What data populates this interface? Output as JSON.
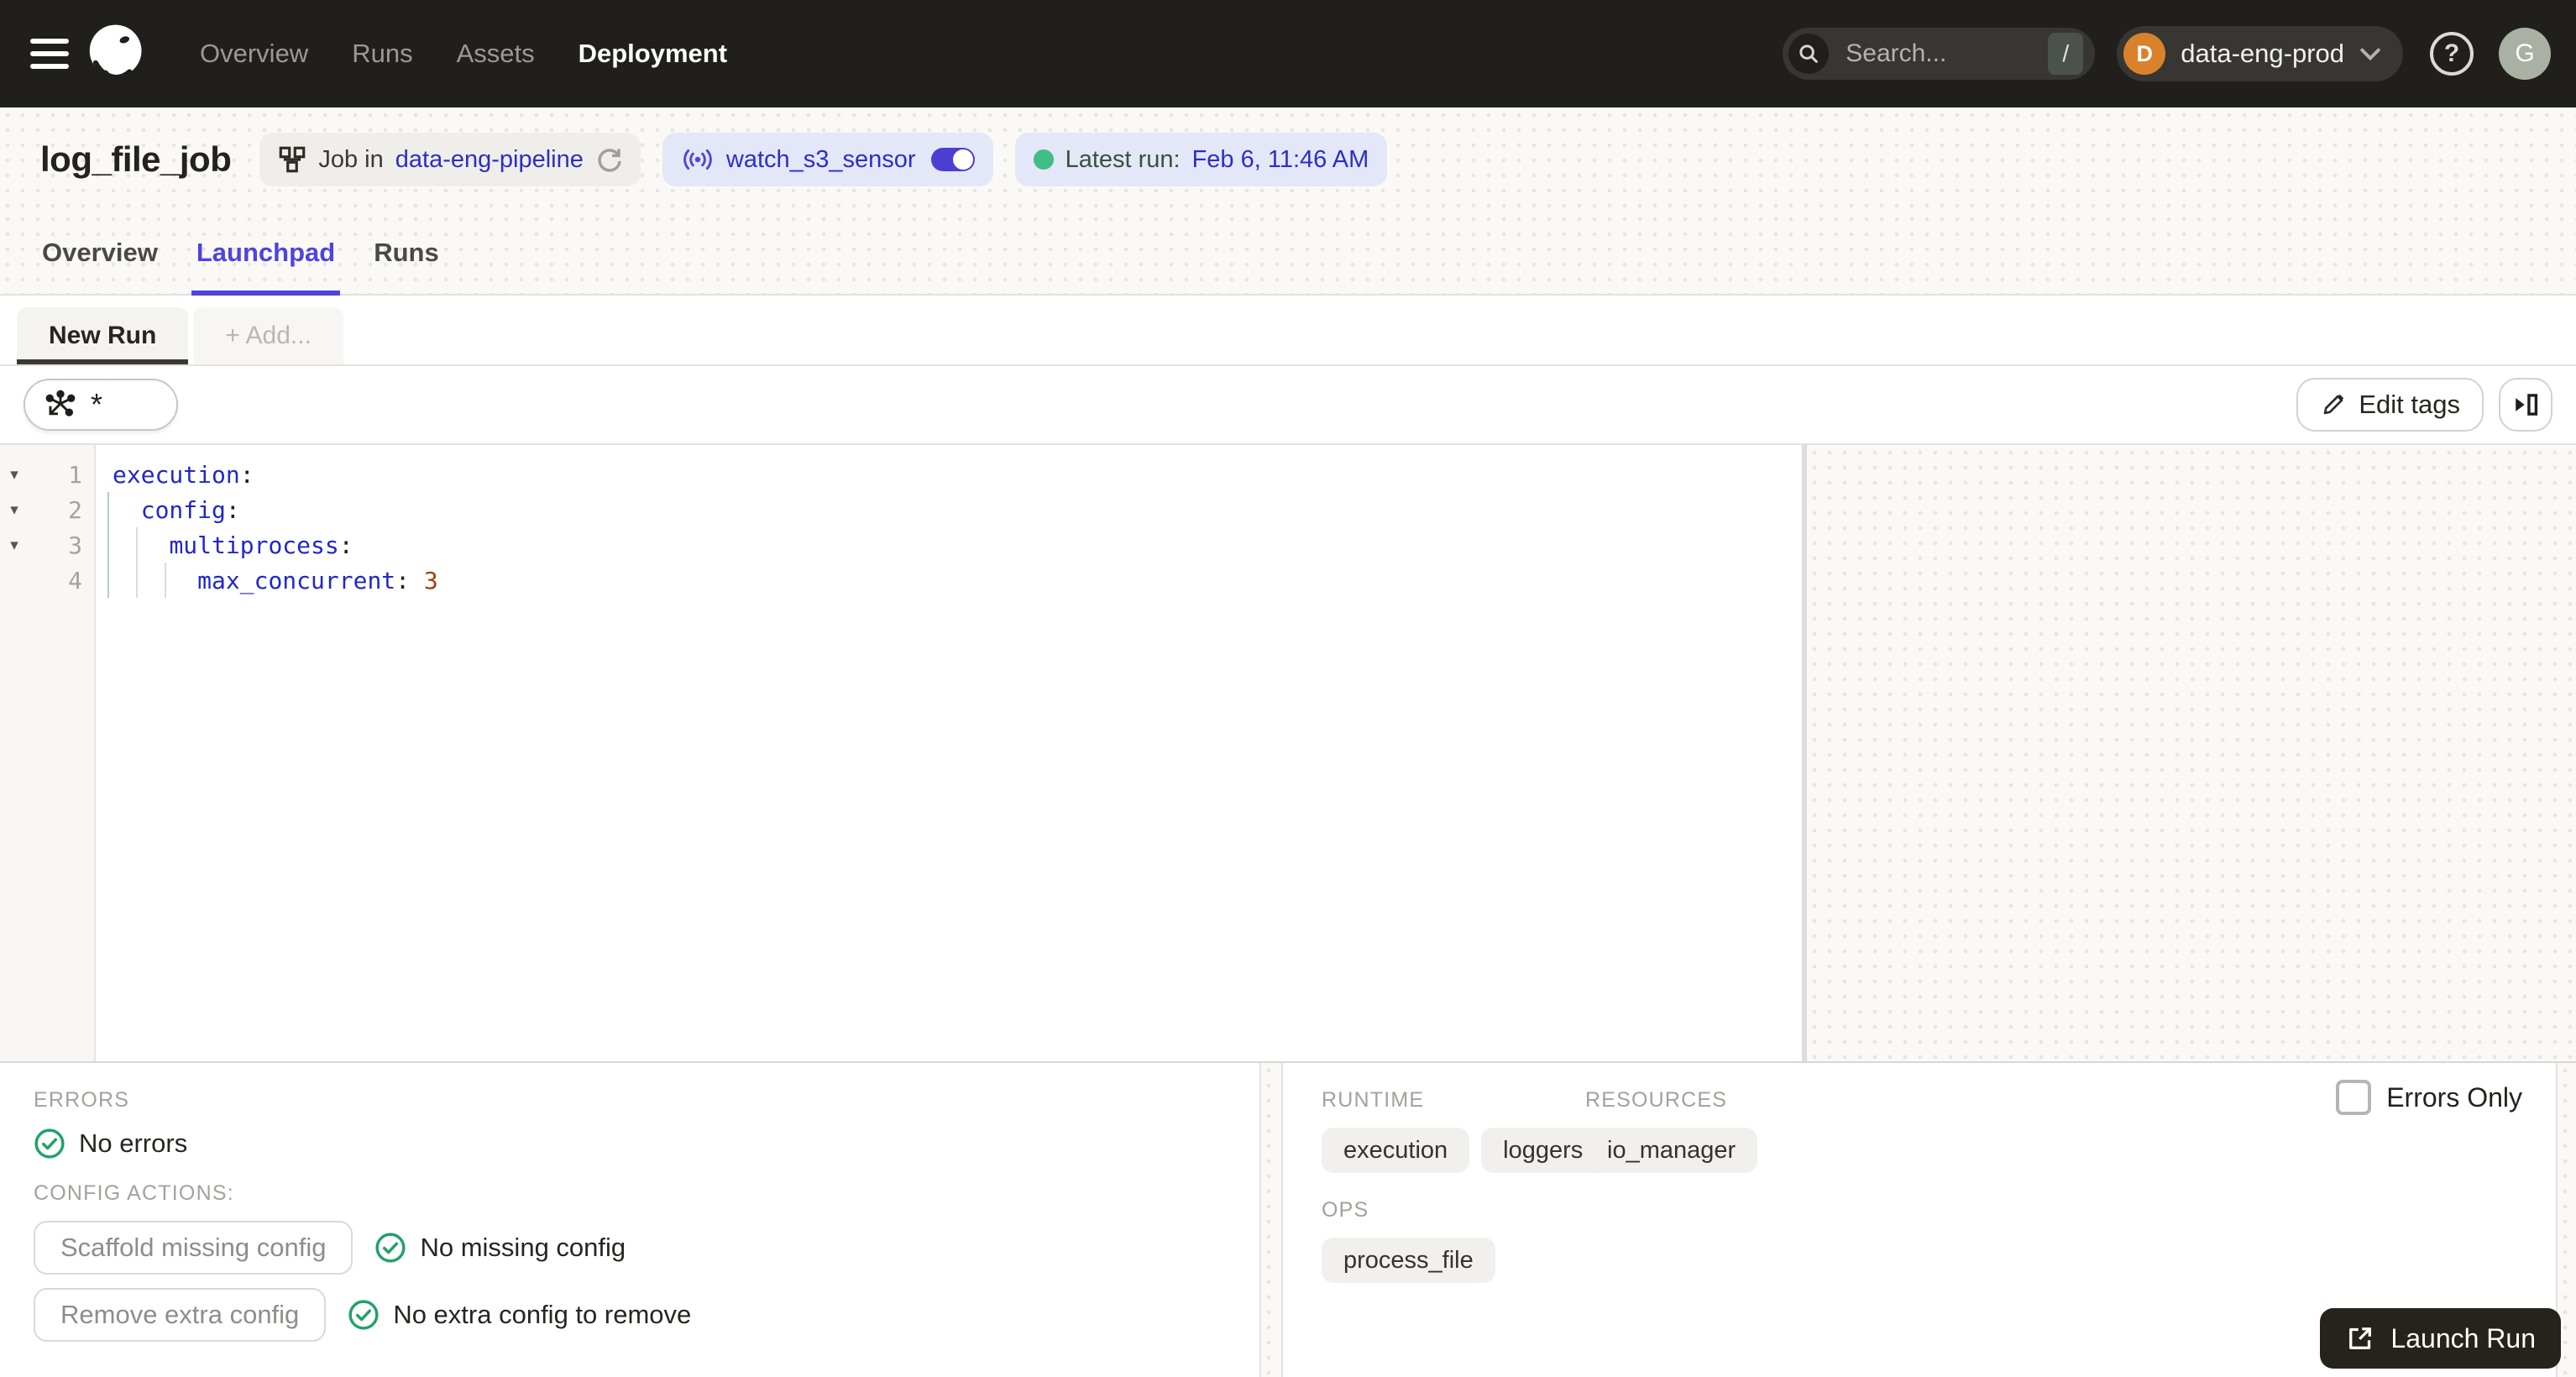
{
  "topnav": {
    "menu_items": [
      "Overview",
      "Runs",
      "Assets",
      "Deployment"
    ],
    "active_item": "Deployment",
    "search_placeholder": "Search...",
    "search_shortcut": "/",
    "workspace": "data-eng-prod",
    "workspace_initial": "D",
    "user_initial": "G",
    "help_glyph": "?"
  },
  "page": {
    "title": "log_file_job",
    "job_badge": {
      "prefix": "Job in",
      "link": "data-eng-pipeline"
    },
    "sensor_badge": {
      "name": "watch_s3_sensor"
    },
    "latest_run": {
      "label": "Latest run:",
      "value": "Feb 6, 11:46 AM"
    }
  },
  "tabs": {
    "overview": "Overview",
    "launchpad": "Launchpad",
    "runs": "Runs",
    "active": "Launchpad"
  },
  "launchpad": {
    "new_run_tab": "New Run",
    "add_tab": "+ Add...",
    "op_selector_value": "*",
    "edit_tags_label": "Edit tags",
    "editor_lines": [
      {
        "num": "1",
        "indent": "",
        "key": "execution",
        "colon": ":",
        "value": ""
      },
      {
        "num": "2",
        "indent": "  ",
        "key": "config",
        "colon": ":",
        "value": ""
      },
      {
        "num": "3",
        "indent": "    ",
        "key": "multiprocess",
        "colon": ":",
        "value": ""
      },
      {
        "num": "4",
        "indent": "      ",
        "key": "max_concurrent",
        "colon": ":",
        "value": "3"
      }
    ]
  },
  "status_panel": {
    "errors_label": "ERRORS",
    "no_errors": "No errors",
    "config_actions_label": "CONFIG ACTIONS:",
    "scaffold_button": "Scaffold missing config",
    "no_missing": "No missing config",
    "remove_button": "Remove extra config",
    "no_extra": "No extra config to remove"
  },
  "config_panel": {
    "runtime_label": "RUNTIME",
    "runtime_tags": [
      "execution",
      "loggers"
    ],
    "resources_label": "RESOURCES",
    "resources_tags": [
      "io_manager"
    ],
    "ops_label": "OPS",
    "ops_tags": [
      "process_file"
    ],
    "errors_only_label": "Errors Only"
  },
  "launch_button": "Launch Run",
  "colors": {
    "topnav_bg": "#211f1c",
    "link_blue": "#2b2fc4",
    "launchpad_active": "#4f43dd",
    "toggle_on": "#4a3fd2",
    "success_green": "#23a169",
    "run_status_green": "#41bd86",
    "workspace_avatar_orange": "#d9822b",
    "code_key_blue": "#2127c8",
    "code_number_red": "#a43f12"
  }
}
